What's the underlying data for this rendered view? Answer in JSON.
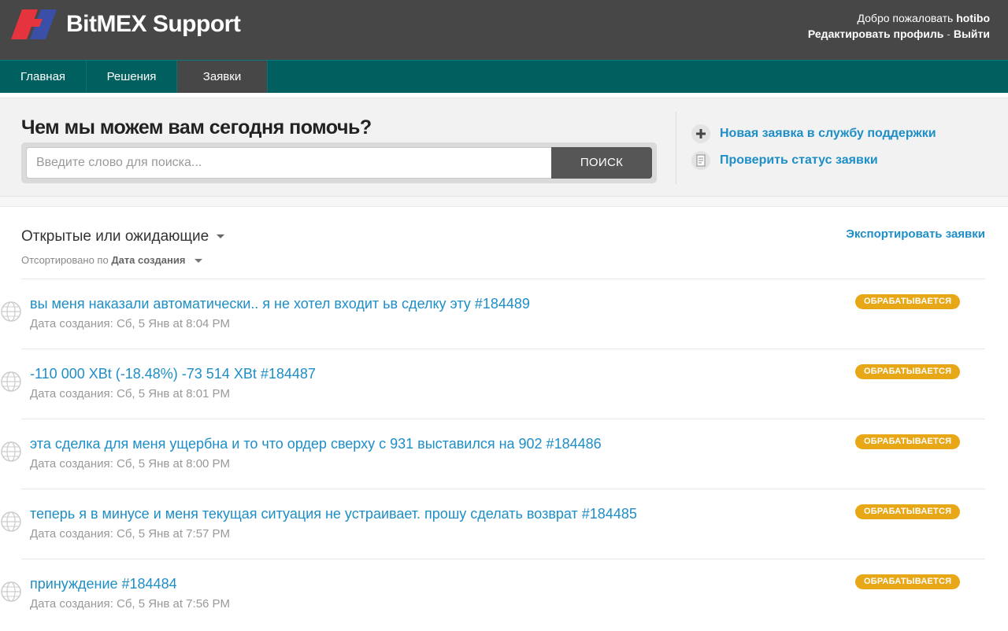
{
  "header": {
    "brand": "BitMEX Support",
    "welcome_prefix": "Добро пожаловать",
    "username": "hotibo",
    "edit_profile": "Редактировать профиль",
    "separator": " - ",
    "logout": "Выйти"
  },
  "nav": {
    "tabs": [
      {
        "label": "Главная"
      },
      {
        "label": "Решения"
      },
      {
        "label": "Заявки"
      }
    ]
  },
  "search": {
    "heading": "Чем мы можем вам сегодня помочь?",
    "placeholder": "Введите слово для поиска...",
    "button": "ПОИСК"
  },
  "side_links": {
    "new_ticket": "Новая заявка в службу поддержки",
    "check_status": "Проверить статус заявки"
  },
  "tickets": {
    "filter_label": "Открытые или ожидающие",
    "sorted_prefix": "Отсортировано по",
    "sorted_by": "Дата создания",
    "export": "Экспортировать заявки",
    "items": [
      {
        "title": "вы меня наказали автоматически.. я не хотел входит ьв сделку эту #184489",
        "date": "Дата создания: Сб, 5 Янв at 8:04 PM",
        "status": "ОБРАБАТЫВАЕТСЯ"
      },
      {
        "title": "-110 000 XBt (-18.48%) -73 514 XBt #184487",
        "date": "Дата создания: Сб, 5 Янв at 8:01 PM",
        "status": "ОБРАБАТЫВАЕТСЯ"
      },
      {
        "title": "эта сделка для меня ущербна и то что ордер сверху с 931 выставился на 902 #184486",
        "date": "Дата создания: Сб, 5 Янв at 8:00 PM",
        "status": "ОБРАБАТЫВАЕТСЯ"
      },
      {
        "title": "теперь я в минусе и меня текущая ситуация не устраивает. прошу сделать возврат #184485",
        "date": "Дата создания: Сб, 5 Янв at 7:57 PM",
        "status": "ОБРАБАТЫВАЕТСЯ"
      },
      {
        "title": "принуждение #184484",
        "date": "Дата создания: Сб, 5 Янв at 7:56 PM",
        "status": "ОБРАБАТЫВАЕТСЯ"
      }
    ]
  },
  "colors": {
    "header_bg": "#474747",
    "nav_bg": "#006060",
    "link": "#1e8ec7",
    "badge": "#e8a716"
  }
}
